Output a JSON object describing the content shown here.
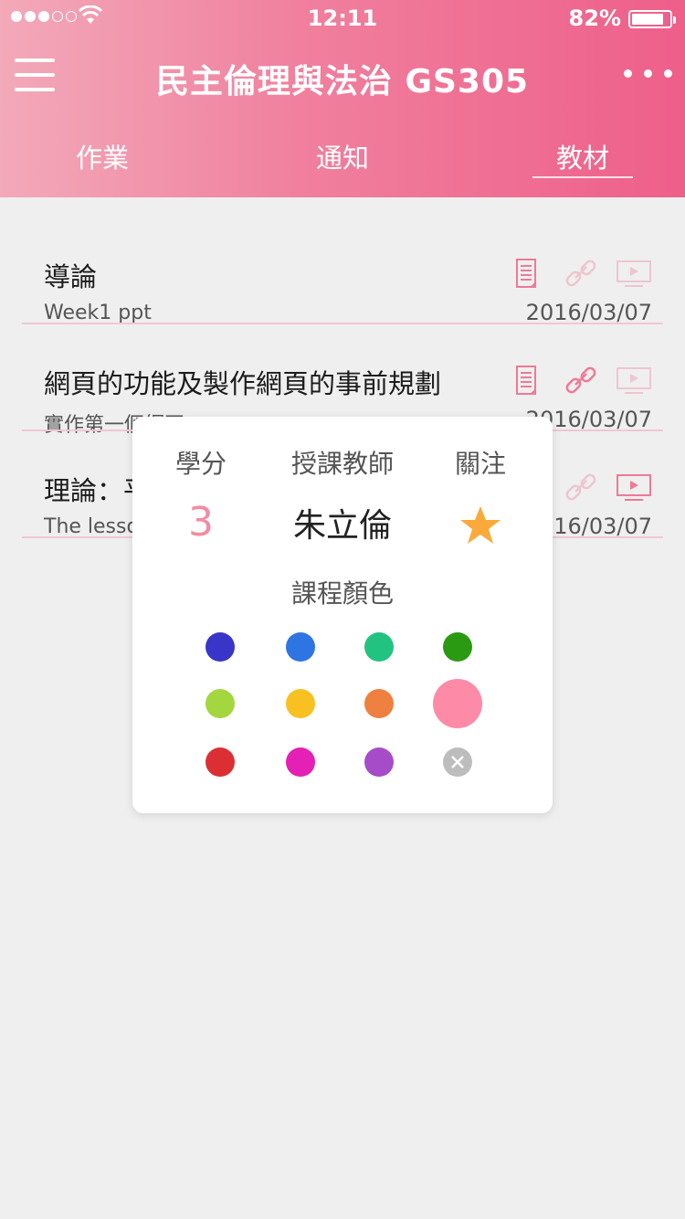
{
  "status_bar": {
    "time": "12:11",
    "battery_percent": "82%"
  },
  "header": {
    "title": "民主倫理與法治 GS305",
    "tabs": [
      {
        "label": "作業",
        "active": false
      },
      {
        "label": "通知",
        "active": false
      },
      {
        "label": "教材",
        "active": true
      }
    ]
  },
  "materials": [
    {
      "title": "導論",
      "subtitle": "Week1 ppt",
      "date": "2016/03/07"
    },
    {
      "title": "網頁的功能及製作網頁的事前規劃",
      "subtitle": "實作第一個網頁",
      "date": "2016/03/07"
    },
    {
      "title": "理論：平",
      "subtitle": "The lesso",
      "date": "2016/03/07"
    }
  ],
  "popup": {
    "credits_label": "學分",
    "credits_value": "3",
    "teacher_label": "授課教師",
    "teacher_value": "朱立倫",
    "follow_label": "關注",
    "color_label": "課程顏色",
    "colors": [
      [
        "#3a35c9",
        "#2f74e3",
        "#22c381",
        "#2a9a12"
      ],
      [
        "#a4d63f",
        "#f8c021",
        "#f08040",
        "#fd8aa6"
      ],
      [
        "#dc2f33",
        "#e520b4",
        "#a64cc9",
        "#bdbdbd"
      ]
    ],
    "selected_color": "#fd8aa6"
  },
  "accent_color": "#f07f9d",
  "star_color": "#fba93a"
}
